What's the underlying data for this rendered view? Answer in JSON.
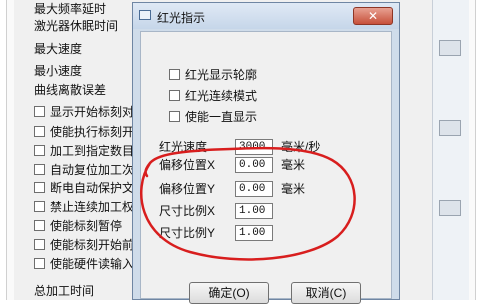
{
  "parent_window": {
    "labels": [
      "最大频率延时",
      "激光器休眠时间",
      "最大速度",
      "最小速度",
      "曲线离散误差"
    ],
    "checkboxes": [
      "显示开始标刻对",
      "使能执行标刻开",
      "加工到指定数目",
      "自动复位加工次",
      "断电自动保护文",
      "禁止连续加工权",
      "使能标刻暂停",
      "使能标刻开始前",
      "使能硬件读输入"
    ],
    "footer_label": "总加工时间"
  },
  "dialog": {
    "title": "红光指示",
    "close_symbol": "✕",
    "checkboxes": [
      "红光显示轮廓",
      "红光连续模式",
      "使能一直显示"
    ],
    "fields": [
      {
        "label": "红光速度",
        "value": "3000",
        "unit": "毫米/秒"
      },
      {
        "label": "偏移位置X",
        "value": "0.00",
        "unit": "毫米"
      },
      {
        "label": "偏移位置Y",
        "value": "0.00",
        "unit": "毫米"
      },
      {
        "label": "尺寸比例X",
        "value": "1.00",
        "unit": ""
      },
      {
        "label": "尺寸比例Y",
        "value": "1.00",
        "unit": ""
      }
    ],
    "ok_label": "确定(O)",
    "cancel_label": "取消(C)"
  },
  "colors": {
    "annotation": "#d81e1e",
    "close_button": "#c7503a",
    "titlebar": "#c6d6e9"
  }
}
